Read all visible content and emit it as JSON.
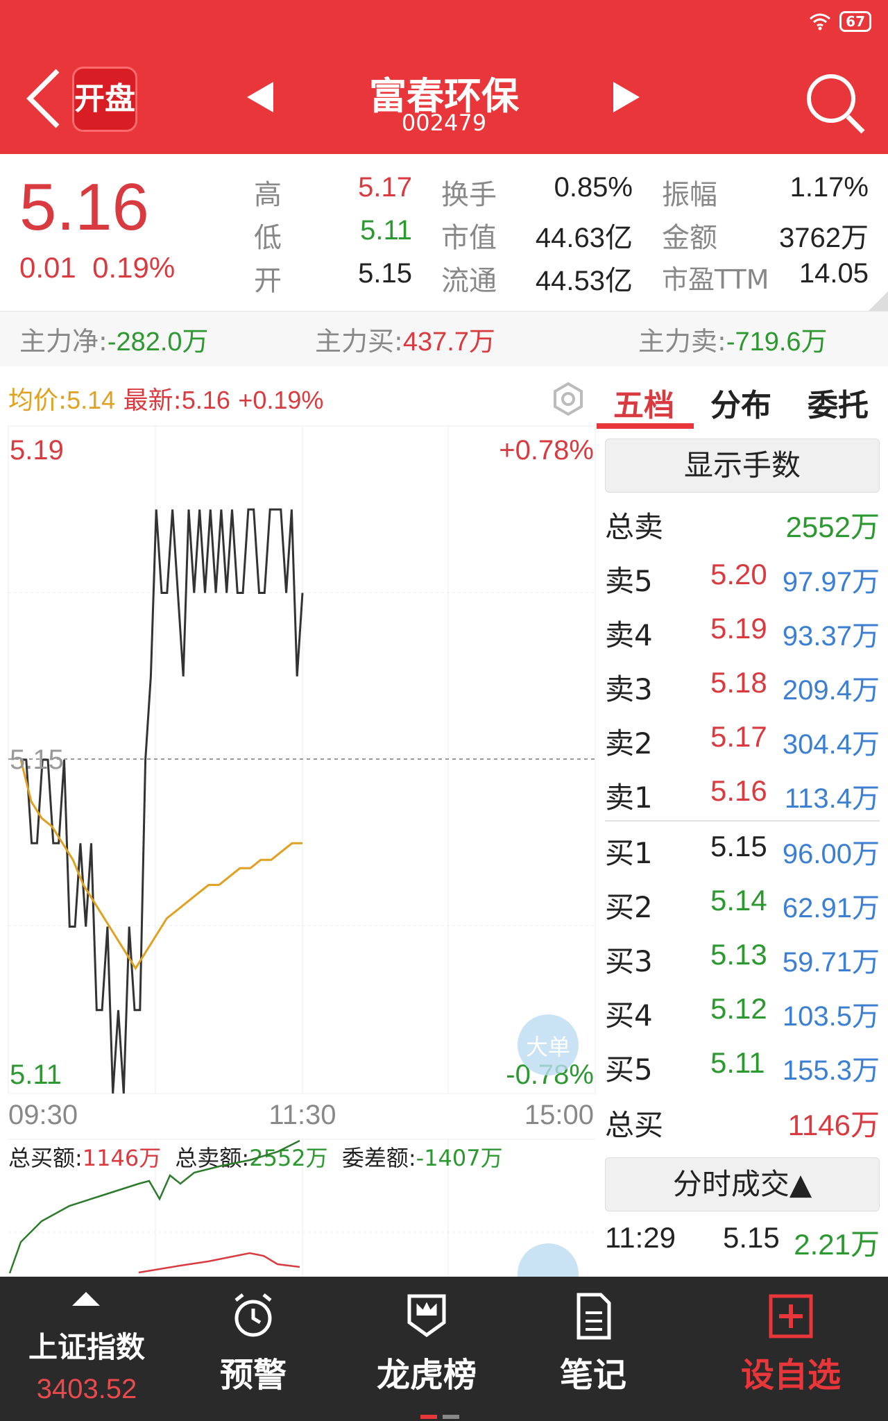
{
  "status": {
    "battery": "67"
  },
  "header": {
    "logo_text": "开盘",
    "stock_name": "富春环保",
    "stock_code": "002479"
  },
  "quote": {
    "price": "5.16",
    "change": "0.01",
    "change_pct": "0.19%",
    "rows": [
      {
        "l1": "高",
        "v1": "5.17",
        "l2": "换手",
        "v2": "0.85%",
        "l3": "振幅",
        "v3": "1.17%"
      },
      {
        "l1": "低",
        "v1": "5.11",
        "l2": "市值",
        "v2": "44.63亿",
        "l3": "金额",
        "v3": "3762万"
      },
      {
        "l1": "开",
        "v1": "5.15",
        "l2": "流通",
        "v2": "44.53亿",
        "l3": "市盈TTM",
        "v3": "14.05"
      }
    ]
  },
  "capital": {
    "net_label": "主力净:",
    "net_value": "-282.0万",
    "buy_label": "主力买:",
    "buy_value": "437.7万",
    "sell_label": "主力卖:",
    "sell_value": "-719.6万"
  },
  "chart_head": {
    "avg_label": "均价:",
    "avg_value": "5.14",
    "latest_label": "最新:",
    "latest_value": "5.16",
    "latest_pct": "+0.19%"
  },
  "tabs": [
    "五档",
    "分布",
    "委托"
  ],
  "chart_data": {
    "type": "line",
    "y_top": "5.19",
    "y_mid": "5.15",
    "y_bottom": "5.11",
    "pct_top": "+0.78%",
    "pct_bottom": "-0.78%",
    "x_labels": [
      "09:30",
      "11:30",
      "15:00"
    ],
    "ylim": [
      5.11,
      5.19
    ],
    "prev_close": 5.15,
    "series": [
      {
        "values": [
          5.15,
          5.15,
          5.14,
          5.14,
          5.15,
          5.15,
          5.14,
          5.14,
          5.15,
          5.13,
          5.13,
          5.14,
          5.13,
          5.14,
          5.12,
          5.12,
          5.13,
          5.11,
          5.12,
          5.11,
          5.13,
          5.12,
          5.12,
          5.15,
          5.16,
          5.18,
          5.17,
          5.17,
          5.18,
          5.17,
          5.16,
          5.18,
          5.17,
          5.18,
          5.17,
          5.18,
          5.17,
          5.18,
          5.17,
          5.18,
          5.17,
          5.17,
          5.18,
          5.18,
          5.17,
          5.17,
          5.18,
          5.18,
          5.18,
          5.17,
          5.18,
          5.16,
          5.17
        ]
      },
      {
        "values": [
          5.15,
          5.145,
          5.143,
          5.142,
          5.14,
          5.138,
          5.135,
          5.133,
          5.131,
          5.129,
          5.127,
          5.125,
          5.127,
          5.129,
          5.131,
          5.132,
          5.133,
          5.134,
          5.135,
          5.135,
          5.136,
          5.137,
          5.137,
          5.138,
          5.138,
          5.139,
          5.14,
          5.14
        ]
      }
    ],
    "badge": "大单"
  },
  "orderbook_totals": {
    "totals_line": {
      "buy_label": "总买额:",
      "buy_value": "1146万",
      "sell_label": "总卖额:",
      "sell_value": "2552万",
      "diff_label": "委差额:",
      "diff_value": "-1407万"
    }
  },
  "orderbook": {
    "show_hands": "显示手数",
    "total_sell_label": "总卖",
    "total_sell": "2552万",
    "asks": [
      {
        "label": "卖5",
        "price": "5.20",
        "vol": "97.97万"
      },
      {
        "label": "卖4",
        "price": "5.19",
        "vol": "93.37万"
      },
      {
        "label": "卖3",
        "price": "5.18",
        "vol": "209.4万"
      },
      {
        "label": "卖2",
        "price": "5.17",
        "vol": "304.4万"
      },
      {
        "label": "卖1",
        "price": "5.16",
        "vol": "113.4万"
      }
    ],
    "bids": [
      {
        "label": "买1",
        "price": "5.15",
        "vol": "96.00万"
      },
      {
        "label": "买2",
        "price": "5.14",
        "vol": "62.91万"
      },
      {
        "label": "买3",
        "price": "5.13",
        "vol": "59.71万"
      },
      {
        "label": "买4",
        "price": "5.12",
        "vol": "103.5万"
      },
      {
        "label": "买5",
        "price": "5.11",
        "vol": "155.3万"
      }
    ],
    "total_buy_label": "总买",
    "total_buy": "1146万",
    "tick_head": "分时成交▲",
    "tick": {
      "time": "11:29",
      "price": "5.15",
      "vol": "2.21万"
    }
  },
  "nav": {
    "index_name": "上证指数",
    "index_value": "3403.52",
    "items": [
      "预警",
      "龙虎榜",
      "笔记",
      "设自选"
    ]
  },
  "colors": {
    "brand": "#e8363a",
    "up": "#d83a3f",
    "down": "#2c9830",
    "volume": "#3b7fd3",
    "avg_line": "#e0a020"
  }
}
